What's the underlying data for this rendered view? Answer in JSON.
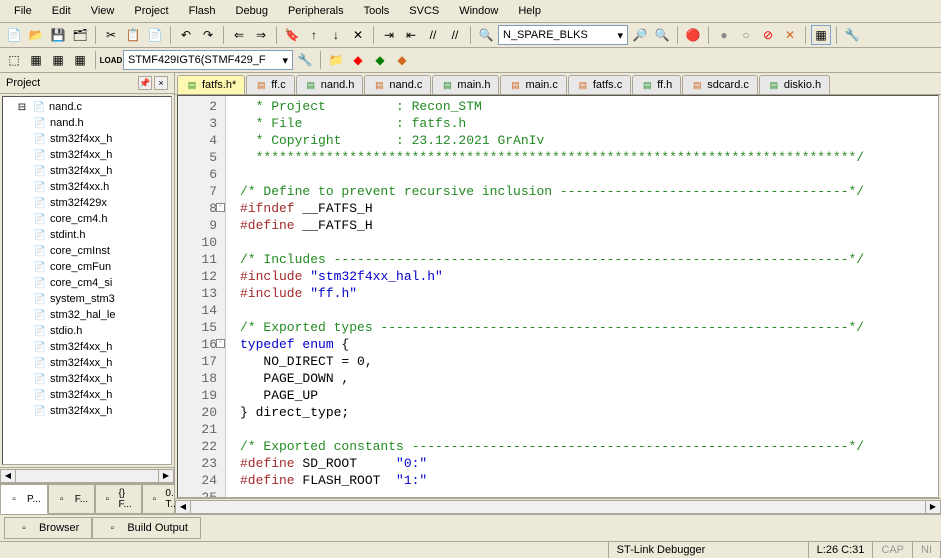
{
  "menu": [
    "File",
    "Edit",
    "View",
    "Project",
    "Flash",
    "Debug",
    "Peripherals",
    "Tools",
    "SVCS",
    "Window",
    "Help"
  ],
  "toolbar1": {
    "combo_value": "N_SPARE_BLKS"
  },
  "toolbar2": {
    "load_label": "LOAD",
    "target_combo": "STMF429IGT6(STMF429_F"
  },
  "project_panel": {
    "title": "Project",
    "root": "nand.c",
    "files": [
      "nand.h",
      "stm32f4xx_h",
      "stm32f4xx_h",
      "stm32f4xx_h",
      "stm32f4xx.h",
      "stm32f429x",
      "core_cm4.h",
      "stdint.h",
      "core_cmInst",
      "core_cmFun",
      "core_cm4_si",
      "system_stm3",
      "stm32_hal_le",
      "stdio.h",
      "stm32f4xx_h",
      "stm32f4xx_h",
      "stm32f4xx_h",
      "stm32f4xx_h",
      "stm32f4xx_h"
    ],
    "tabs": [
      "P...",
      "F...",
      "{} F...",
      "0. T..."
    ]
  },
  "file_tabs": [
    {
      "name": "fatfs.h*",
      "active": true,
      "kind": "h"
    },
    {
      "name": "ff.c",
      "active": false,
      "kind": "c"
    },
    {
      "name": "nand.h",
      "active": false,
      "kind": "h"
    },
    {
      "name": "nand.c",
      "active": false,
      "kind": "c"
    },
    {
      "name": "main.h",
      "active": false,
      "kind": "h"
    },
    {
      "name": "main.c",
      "active": false,
      "kind": "c"
    },
    {
      "name": "fatfs.c",
      "active": false,
      "kind": "c"
    },
    {
      "name": "ff.h",
      "active": false,
      "kind": "h"
    },
    {
      "name": "sdcard.c",
      "active": false,
      "kind": "c"
    },
    {
      "name": "diskio.h",
      "active": false,
      "kind": "h"
    }
  ],
  "code": {
    "first_line": 2,
    "lines": [
      {
        "n": 2,
        "cls": "c-comment",
        "text": "  * Project         : Recon_STM"
      },
      {
        "n": 3,
        "cls": "c-comment",
        "text": "  * File            : fatfs.h"
      },
      {
        "n": 4,
        "cls": "c-comment",
        "text": "  * Copyright       : 23.12.2021 GrAnIv"
      },
      {
        "n": 5,
        "cls": "c-comment",
        "text": "  *****************************************************************************/"
      },
      {
        "n": 6,
        "cls": "",
        "text": ""
      },
      {
        "n": 7,
        "cls": "c-comment",
        "text": "/* Define to prevent recursive inclusion -------------------------------------*/"
      },
      {
        "n": 8,
        "cls": "",
        "fold": "-",
        "html": "<span class='c-preproc'>#ifndef</span> __FATFS_H"
      },
      {
        "n": 9,
        "cls": "",
        "html": "<span class='c-preproc'>#define</span> __FATFS_H"
      },
      {
        "n": 10,
        "cls": "",
        "text": ""
      },
      {
        "n": 11,
        "cls": "c-comment",
        "text": "/* Includes ------------------------------------------------------------------*/"
      },
      {
        "n": 12,
        "cls": "",
        "html": "<span class='c-preproc'>#include</span> <span class='c-string'>\"stm32f4xx_hal.h\"</span>"
      },
      {
        "n": 13,
        "cls": "",
        "html": "<span class='c-preproc'>#include</span> <span class='c-string'>\"ff.h\"</span>"
      },
      {
        "n": 14,
        "cls": "",
        "text": ""
      },
      {
        "n": 15,
        "cls": "c-comment",
        "text": "/* Exported types ------------------------------------------------------------*/"
      },
      {
        "n": 16,
        "cls": "",
        "fold": "-",
        "html": "<span class='c-keyword'>typedef enum</span> {"
      },
      {
        "n": 17,
        "cls": "",
        "text": "   NO_DIRECT = 0,"
      },
      {
        "n": 18,
        "cls": "",
        "text": "   PAGE_DOWN ,"
      },
      {
        "n": 19,
        "cls": "",
        "text": "   PAGE_UP"
      },
      {
        "n": 20,
        "cls": "",
        "text": "} direct_type;"
      },
      {
        "n": 21,
        "cls": "",
        "text": ""
      },
      {
        "n": 22,
        "cls": "c-comment",
        "text": "/* Exported constants --------------------------------------------------------*/"
      },
      {
        "n": 23,
        "cls": "",
        "html": "<span class='c-preproc'>#define</span> SD_ROOT     <span class='c-string'>\"0:\"</span>"
      },
      {
        "n": 24,
        "cls": "",
        "html": "<span class='c-preproc'>#define</span> FLASH_ROOT  <span class='c-string'>\"1:\"</span>"
      },
      {
        "n": 25,
        "cls": "",
        "text": ""
      }
    ]
  },
  "bottom_tabs": [
    "Browser",
    "Build Output"
  ],
  "status": {
    "debugger": "ST-Link Debugger",
    "pos": "L:26 C:31",
    "cap": "CAP",
    "ni": "NI"
  }
}
